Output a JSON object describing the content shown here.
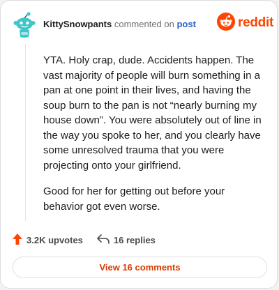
{
  "header": {
    "username": "KittySnowpants",
    "commented": "commented on",
    "post_link": "post",
    "brand": "reddit"
  },
  "comment": {
    "paragraphs": [
      "YTA. Holy crap, dude. Accidents happen. The vast majority of people will burn something in a pan at one point in their lives, and having the soup burn to the pan is not “nearly burning my house down”. You were absolutely out of line in the way you spoke to her, and you clearly have some unresolved trauma that you were projecting onto your girlfriend.",
      "Good for her for getting out before your behavior got even worse."
    ]
  },
  "actions": {
    "upvotes": "3.2K upvotes",
    "replies": "16 replies"
  },
  "footer": {
    "view_label": "View 16 comments"
  },
  "colors": {
    "accent": "#ff4500",
    "link": "#2a63c6",
    "view_text": "#d93a00"
  },
  "icons": {
    "avatar": "snoo-avatar-icon",
    "brand": "reddit-logo-icon",
    "upvote": "upvote-arrow-icon",
    "reply": "reply-arrow-icon"
  }
}
